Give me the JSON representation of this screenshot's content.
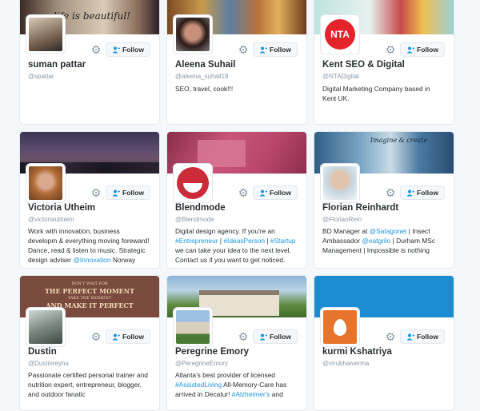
{
  "follow_label": "Follow",
  "colors": {
    "accent": "#1b95e0",
    "muted": "#8899a6",
    "border": "#e1e8ed"
  },
  "cards": [
    {
      "name": "suman pattar",
      "handle": "@spattar",
      "banner_text": "life is beautiful!",
      "bio": []
    },
    {
      "name": "Aleena Suhail",
      "handle": "@aleena_suhail18",
      "bio": [
        [
          {
            "t": "SEO, travel, cook!!!"
          }
        ]
      ]
    },
    {
      "name": "Kent SEO & Digital",
      "handle": "@NTADigital",
      "avatar_text": "NTA",
      "bio": [
        [
          {
            "t": "Digital Marketing Company based in"
          }
        ],
        [
          {
            "t": "Kent UK."
          }
        ]
      ]
    },
    {
      "name": "Victoria Utheim",
      "handle": "@victoriautheim",
      "bio": [
        [
          {
            "t": "Work with innovation, business"
          }
        ],
        [
          {
            "t": "developm & everything moving foreward!"
          }
        ],
        [
          {
            "t": "Dance, read & listen to music. Strategic"
          }
        ],
        [
          {
            "t": "design adviser "
          },
          {
            "t": "@Innovation",
            "l": true
          },
          {
            "t": " Norway"
          }
        ]
      ]
    },
    {
      "name": "Blendmode",
      "handle": "@Blendmode",
      "bio": [
        [
          {
            "t": "Digital design agency. If you're an"
          }
        ],
        [
          {
            "t": "#Entrepreneur",
            "l": true
          },
          {
            "t": " | "
          },
          {
            "t": "#IdeasPerson",
            "l": true
          },
          {
            "t": " | "
          },
          {
            "t": "#Startup",
            "l": true
          }
        ],
        [
          {
            "t": "we can take your idea to the next level."
          }
        ],
        [
          {
            "t": "Contact us if you want to get noticed."
          }
        ]
      ]
    },
    {
      "name": "Florian Reinhardt",
      "handle": "@FlorianRein",
      "banner_text": "Imagine & create",
      "bio": [
        [
          {
            "t": "BD Manager at "
          },
          {
            "t": "@Satagonet",
            "l": true
          },
          {
            "t": " | Insect"
          }
        ],
        [
          {
            "t": "Ambassador "
          },
          {
            "t": "@eatgrilo",
            "l": true
          },
          {
            "t": " | Durham MSc"
          }
        ],
        [
          {
            "t": "Management | Impossible is nothing"
          }
        ]
      ]
    },
    {
      "name": "Dustin",
      "handle": "@Dustinreyna",
      "banner_lines": [
        "DON'T WAIT FOR",
        "THE PERFECT MOMENT",
        "TAKE THE MOMENT",
        "AND MAKE IT PERFECT"
      ],
      "bio": [
        [
          {
            "t": "Passionate certified personal trainer and"
          }
        ],
        [
          {
            "t": "nutrition expert, entrepreneur, blogger,"
          }
        ],
        [
          {
            "t": "and outdoor fanatic"
          }
        ]
      ]
    },
    {
      "name": "Peregrine Emory",
      "handle": "@PeregrineEmory",
      "bio": [
        [
          {
            "t": "Atlanta's best provider of licensed"
          }
        ],
        [
          {
            "t": "#AssistedLiving",
            "l": true
          },
          {
            "t": " All-Memory-Care has"
          }
        ],
        [
          {
            "t": "arrived in Decatur! "
          },
          {
            "t": "#Alzheimer's",
            "l": true
          },
          {
            "t": " and"
          }
        ]
      ]
    },
    {
      "name": "kurmi Kshatriya",
      "handle": "@virubhaiverma",
      "bio": []
    }
  ]
}
